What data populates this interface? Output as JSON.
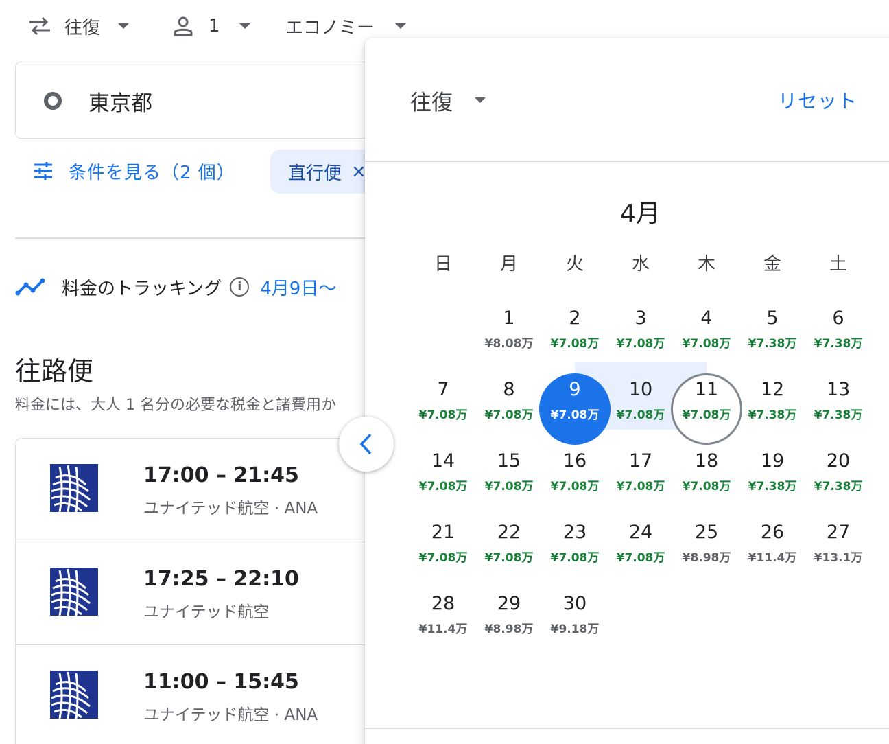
{
  "topbar": {
    "trip_type": "往復",
    "passengers": "1",
    "cabin_class": "エコノミー"
  },
  "origin": {
    "value": "東京都"
  },
  "filters": {
    "view_conditions": "条件を見る（2 個）",
    "nonstop_chip": "直行便",
    "chip_close": "×"
  },
  "tracking": {
    "label": "料金のトラッキング",
    "info": "i",
    "date_range": "4月9日〜"
  },
  "outbound": {
    "title": "往路便",
    "subtitle": "料金には、大人 1 名分の必要な税金と諸費用か",
    "flights": [
      {
        "time": "17:00 – 21:45",
        "airline": "ユナイテッド航空 · ANA"
      },
      {
        "time": "17:25 – 22:10",
        "airline": "ユナイテッド航空"
      },
      {
        "time": "11:00 – 15:45",
        "airline": "ユナイテッド航空 · ANA"
      }
    ]
  },
  "calendar": {
    "trip_type": "往復",
    "reset": "リセット",
    "month": "4月",
    "weekdays": [
      "日",
      "月",
      "火",
      "水",
      "木",
      "金",
      "土"
    ],
    "days": [
      {
        "day": "1",
        "price": "¥8.08万",
        "low": false
      },
      {
        "day": "2",
        "price": "¥7.08万",
        "low": true
      },
      {
        "day": "3",
        "price": "¥7.08万",
        "low": true
      },
      {
        "day": "4",
        "price": "¥7.08万",
        "low": true
      },
      {
        "day": "5",
        "price": "¥7.38万",
        "low": true
      },
      {
        "day": "6",
        "price": "¥7.38万",
        "low": true
      },
      {
        "day": "7",
        "price": "¥7.08万",
        "low": true
      },
      {
        "day": "8",
        "price": "¥7.08万",
        "low": true
      },
      {
        "day": "9",
        "price": "¥7.08万",
        "low": true,
        "selected": "start"
      },
      {
        "day": "10",
        "price": "¥7.08万",
        "low": true
      },
      {
        "day": "11",
        "price": "¥7.08万",
        "low": true,
        "selected": "end"
      },
      {
        "day": "12",
        "price": "¥7.38万",
        "low": true
      },
      {
        "day": "13",
        "price": "¥7.38万",
        "low": true
      },
      {
        "day": "14",
        "price": "¥7.08万",
        "low": true
      },
      {
        "day": "15",
        "price": "¥7.08万",
        "low": true
      },
      {
        "day": "16",
        "price": "¥7.08万",
        "low": true
      },
      {
        "day": "17",
        "price": "¥7.08万",
        "low": true
      },
      {
        "day": "18",
        "price": "¥7.08万",
        "low": true
      },
      {
        "day": "19",
        "price": "¥7.38万",
        "low": true
      },
      {
        "day": "20",
        "price": "¥7.38万",
        "low": true
      },
      {
        "day": "21",
        "price": "¥7.08万",
        "low": true
      },
      {
        "day": "22",
        "price": "¥7.08万",
        "low": true
      },
      {
        "day": "23",
        "price": "¥7.08万",
        "low": true
      },
      {
        "day": "24",
        "price": "¥7.08万",
        "low": true
      },
      {
        "day": "25",
        "price": "¥8.98万",
        "low": false
      },
      {
        "day": "26",
        "price": "¥11.4万",
        "low": false
      },
      {
        "day": "27",
        "price": "¥13.1万",
        "low": false
      },
      {
        "day": "28",
        "price": "¥11.4万",
        "low": false
      },
      {
        "day": "29",
        "price": "¥8.98万",
        "low": false
      },
      {
        "day": "30",
        "price": "¥9.18万",
        "low": false
      }
    ]
  },
  "colors": {
    "accent": "#1a73e8",
    "low_price": "#188038",
    "range": "#e8f0fe",
    "airline_logo": "#1f3590"
  }
}
